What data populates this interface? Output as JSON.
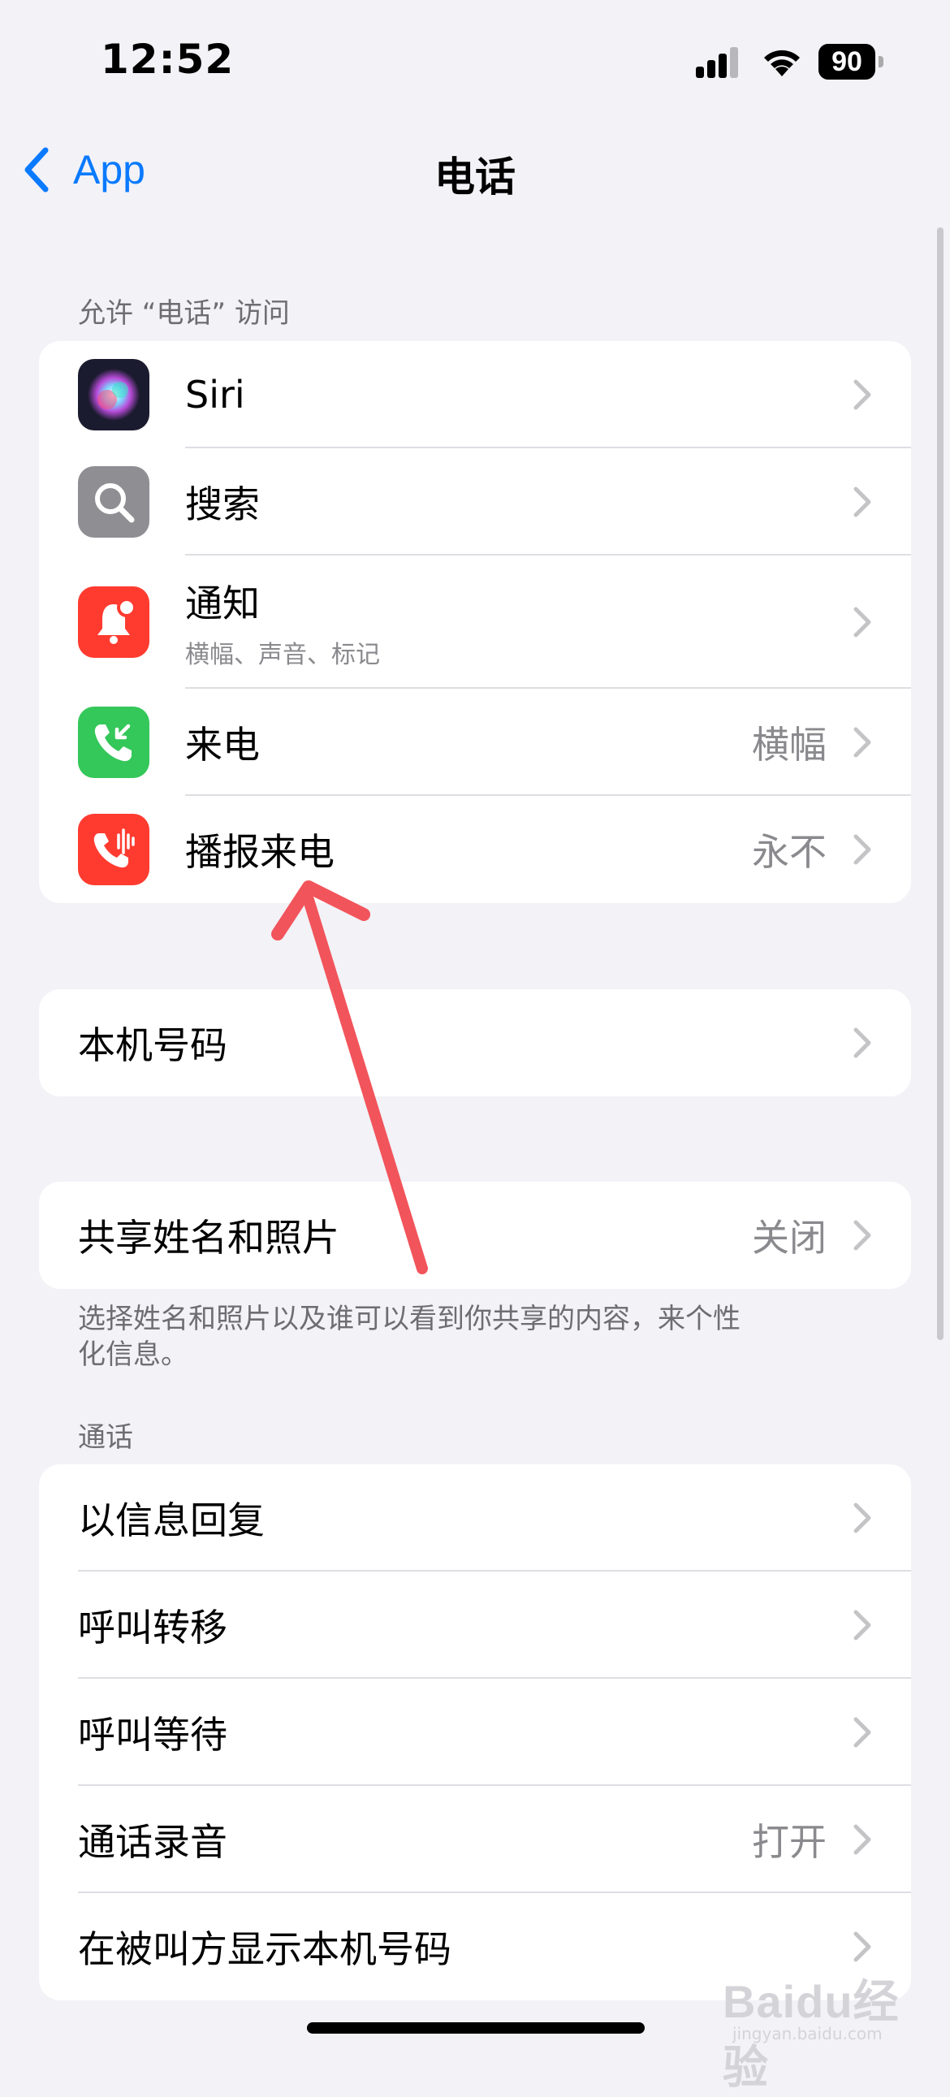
{
  "status_bar": {
    "time": "12:52",
    "battery": "90"
  },
  "nav": {
    "back_label": "App",
    "title": "电话"
  },
  "section_allow": {
    "header": "允许 “电话” 访问",
    "items": [
      {
        "label": "Siri",
        "icon": "siri-icon"
      },
      {
        "label": "搜索",
        "icon": "search-icon"
      },
      {
        "label": "通知",
        "subtitle": "横幅、声音、标记",
        "icon": "notification-bell-icon"
      },
      {
        "label": "来电",
        "value": "横幅",
        "icon": "incoming-call-icon"
      },
      {
        "label": "播报来电",
        "value": "永不",
        "icon": "announce-calls-icon"
      }
    ]
  },
  "my_number": {
    "label": "本机号码"
  },
  "share": {
    "label": "共享姓名和照片",
    "value": "关闭",
    "footer": "选择姓名和照片以及谁可以看到你共享的内容，来个性化信息。"
  },
  "section_calls": {
    "header": "通话",
    "items": [
      {
        "label": "以信息回复"
      },
      {
        "label": "呼叫转移"
      },
      {
        "label": "呼叫等待"
      },
      {
        "label": "通话录音",
        "value": "打开"
      },
      {
        "label": "在被叫方显示本机号码"
      }
    ]
  },
  "watermark": {
    "main": "Baidu经验",
    "sub": "jingyan.baidu.com"
  },
  "colors": {
    "accent": "#0a7aff",
    "background": "#f2f2f7",
    "annotation_arrow": "#f2545b"
  }
}
